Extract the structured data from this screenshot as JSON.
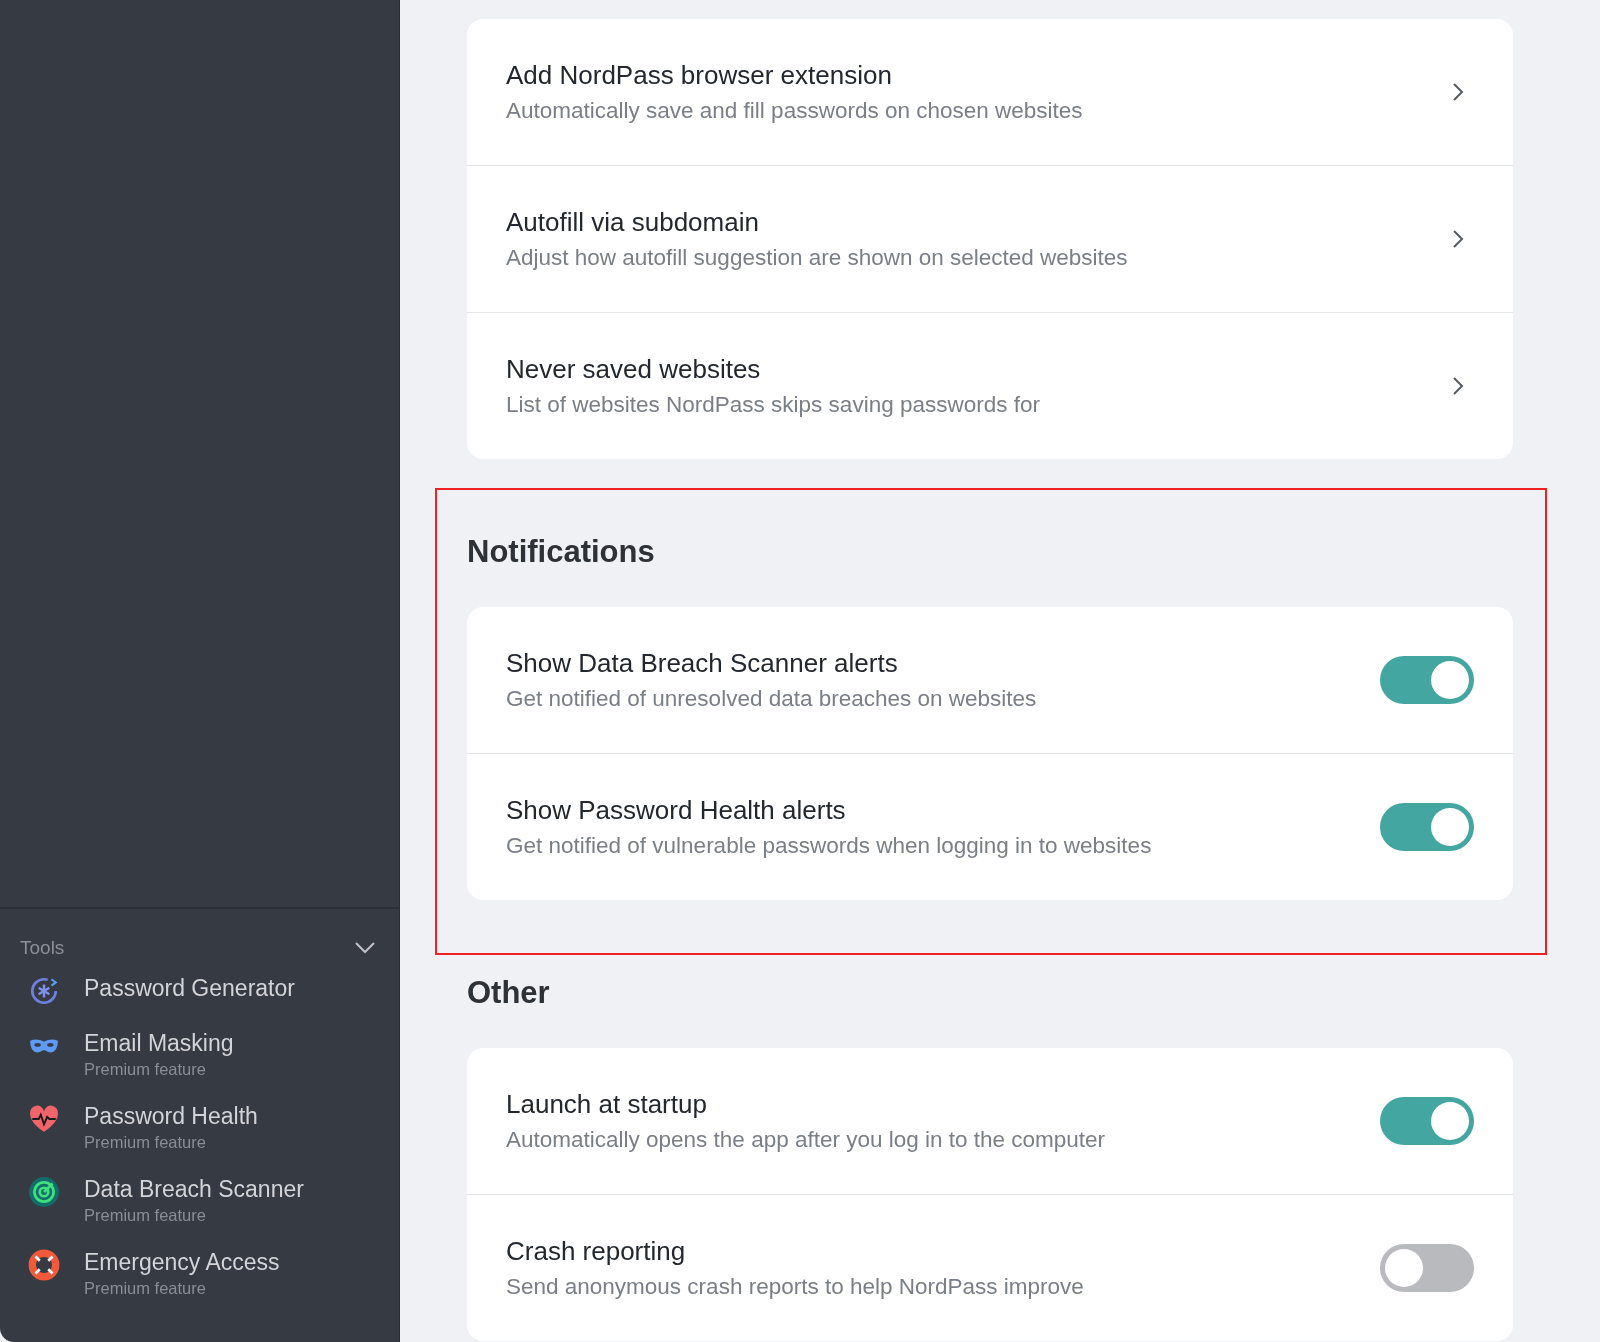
{
  "sidebar": {
    "tools": {
      "label": "Tools",
      "expanded": true,
      "items": [
        {
          "name": "Password Generator"
        },
        {
          "name": "Email Masking",
          "subtitle": "Premium feature"
        },
        {
          "name": "Password Health",
          "subtitle": "Premium feature"
        },
        {
          "name": "Data Breach Scanner",
          "subtitle": "Premium feature"
        },
        {
          "name": "Emergency Access",
          "subtitle": "Premium feature"
        }
      ]
    }
  },
  "sections": [
    {
      "highlighted": false,
      "rows": [
        {
          "kind": "link",
          "title": "Add NordPass browser extension",
          "subtitle": "Automatically save and fill passwords on chosen websites"
        },
        {
          "kind": "link",
          "title": "Autofill via subdomain",
          "subtitle": "Adjust how autofill suggestion are shown on selected websites"
        },
        {
          "kind": "link",
          "title": "Never saved websites",
          "subtitle": "List of websites NordPass skips saving passwords for"
        }
      ]
    },
    {
      "heading": "Notifications",
      "highlighted": true,
      "rows": [
        {
          "kind": "toggle",
          "title": "Show Data Breach Scanner alerts",
          "subtitle": "Get notified of unresolved data breaches on websites",
          "on": true
        },
        {
          "kind": "toggle",
          "title": "Show Password Health alerts",
          "subtitle": "Get notified of vulnerable passwords when logging in to websites",
          "on": true
        }
      ]
    },
    {
      "heading": "Other",
      "highlighted": false,
      "rows": [
        {
          "kind": "toggle",
          "title": "Launch at startup",
          "subtitle": "Automatically opens the app after you log in to the computer",
          "on": true
        },
        {
          "kind": "toggle",
          "title": "Crash reporting",
          "subtitle": "Send anonymous crash reports to help NordPass improve",
          "on": false
        }
      ]
    }
  ]
}
